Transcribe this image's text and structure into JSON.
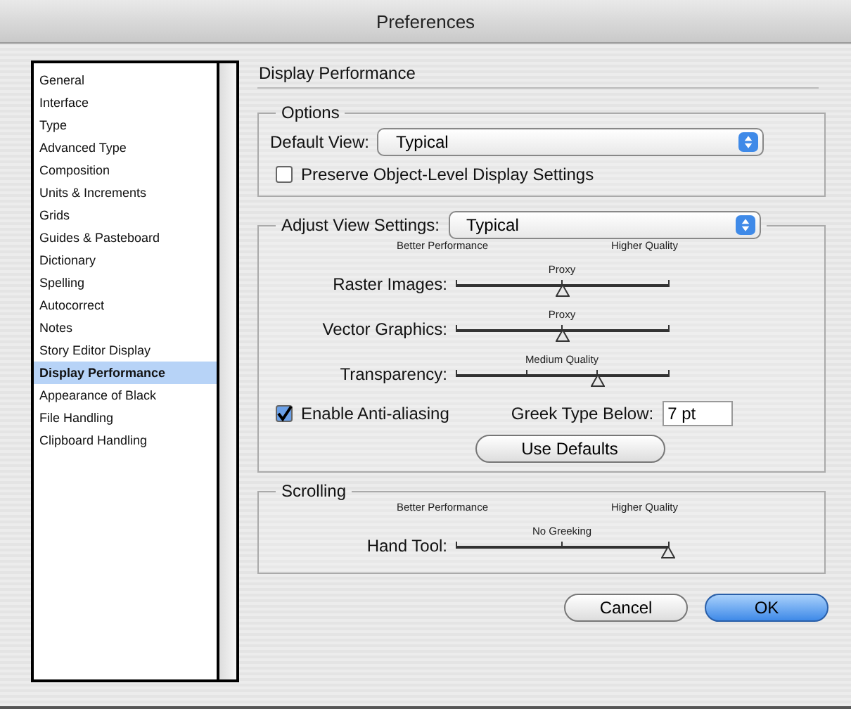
{
  "window": {
    "title": "Preferences"
  },
  "sidebar": {
    "items": [
      {
        "label": "General",
        "selected": false
      },
      {
        "label": "Interface",
        "selected": false
      },
      {
        "label": "Type",
        "selected": false
      },
      {
        "label": "Advanced Type",
        "selected": false
      },
      {
        "label": "Composition",
        "selected": false
      },
      {
        "label": "Units & Increments",
        "selected": false
      },
      {
        "label": "Grids",
        "selected": false
      },
      {
        "label": "Guides & Pasteboard",
        "selected": false
      },
      {
        "label": "Dictionary",
        "selected": false
      },
      {
        "label": "Spelling",
        "selected": false
      },
      {
        "label": "Autocorrect",
        "selected": false
      },
      {
        "label": "Notes",
        "selected": false
      },
      {
        "label": "Story Editor Display",
        "selected": false
      },
      {
        "label": "Display Performance",
        "selected": true
      },
      {
        "label": "Appearance of Black",
        "selected": false
      },
      {
        "label": "File Handling",
        "selected": false
      },
      {
        "label": "Clipboard Handling",
        "selected": false
      }
    ]
  },
  "heading": "Display Performance",
  "options": {
    "legend": "Options",
    "default_view_label": "Default View:",
    "default_view": "Typical",
    "preserve": {
      "label": "Preserve Object-Level Display Settings",
      "checked": false
    }
  },
  "adjust": {
    "label": "Adjust View Settings:",
    "value": "Typical",
    "left_caption": "Better Performance",
    "right_caption": "Higher Quality",
    "sliders": [
      {
        "label": "Raster Images:",
        "caption": "Proxy",
        "kind": "three-stop",
        "level": 0.5
      },
      {
        "label": "Vector Graphics:",
        "caption": "Proxy",
        "kind": "three-stop",
        "level": 0.5
      },
      {
        "label": "Transparency:",
        "caption": "Medium Quality",
        "kind": "four-stop",
        "level": 0.667
      }
    ],
    "antialias": {
      "label": "Enable Anti-aliasing",
      "checked": true
    },
    "greek_label": "Greek Type Below:",
    "greek_value": "7 pt",
    "defaults_button": "Use Defaults"
  },
  "scrolling": {
    "legend": "Scrolling",
    "left_caption": "Better Performance",
    "right_caption": "Higher Quality",
    "sliders": [
      {
        "label": "Hand Tool:",
        "caption": "No Greeking",
        "kind": "three-stop",
        "level": 1
      }
    ]
  },
  "buttons": {
    "cancel": "Cancel",
    "ok": "OK"
  }
}
